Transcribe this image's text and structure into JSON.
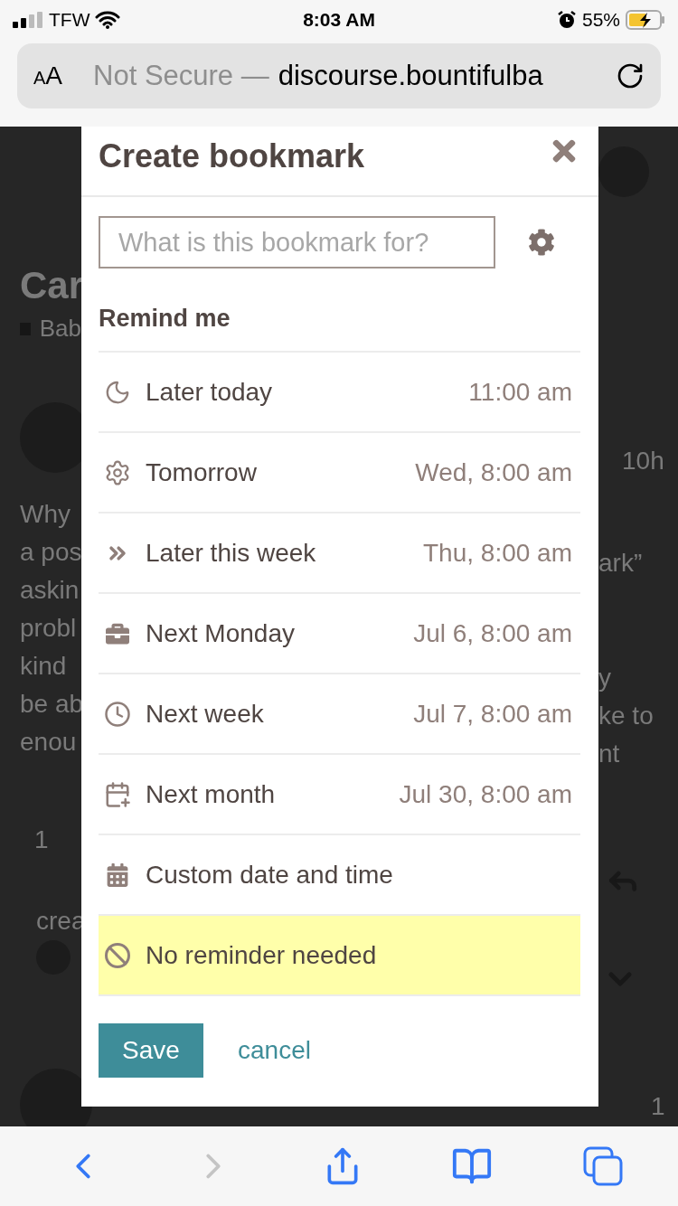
{
  "status_bar": {
    "carrier": "TFW",
    "time": "8:03 AM",
    "battery": "55%"
  },
  "address_bar": {
    "text_size_button": "AA",
    "security": "Not Secure —",
    "url": "discourse.bountifulba"
  },
  "background_page": {
    "title": "Car",
    "category": "Bab",
    "post_time": "10h",
    "text_left": [
      "Why",
      "a pos",
      "askin",
      "probl",
      "kind",
      "be ab",
      "enou"
    ],
    "text_right": [
      "ark”",
      "y",
      "ke to",
      "nt"
    ],
    "post_count": "1",
    "created_label": "crea",
    "reply_count": "1"
  },
  "modal": {
    "title": "Create bookmark",
    "name_field": {
      "placeholder": "What is this bookmark for?"
    },
    "section_label": "Remind me",
    "options": [
      {
        "label": "Later today",
        "time": "11:00 am",
        "selected": false
      },
      {
        "label": "Tomorrow",
        "time": "Wed, 8:00 am",
        "selected": false
      },
      {
        "label": "Later this week",
        "time": "Thu, 8:00 am",
        "selected": false
      },
      {
        "label": "Next Monday",
        "time": "Jul 6, 8:00 am",
        "selected": false
      },
      {
        "label": "Next week",
        "time": "Jul 7, 8:00 am",
        "selected": false
      },
      {
        "label": "Next month",
        "time": "Jul 30, 8:00 am",
        "selected": false
      },
      {
        "label": "Custom date and time",
        "selected": false
      },
      {
        "label": "No reminder needed",
        "selected": true
      }
    ],
    "save_button": "Save",
    "cancel_link": "cancel"
  },
  "browser_toolbar": {
    "back_disabled": false,
    "forward_disabled": true
  }
}
